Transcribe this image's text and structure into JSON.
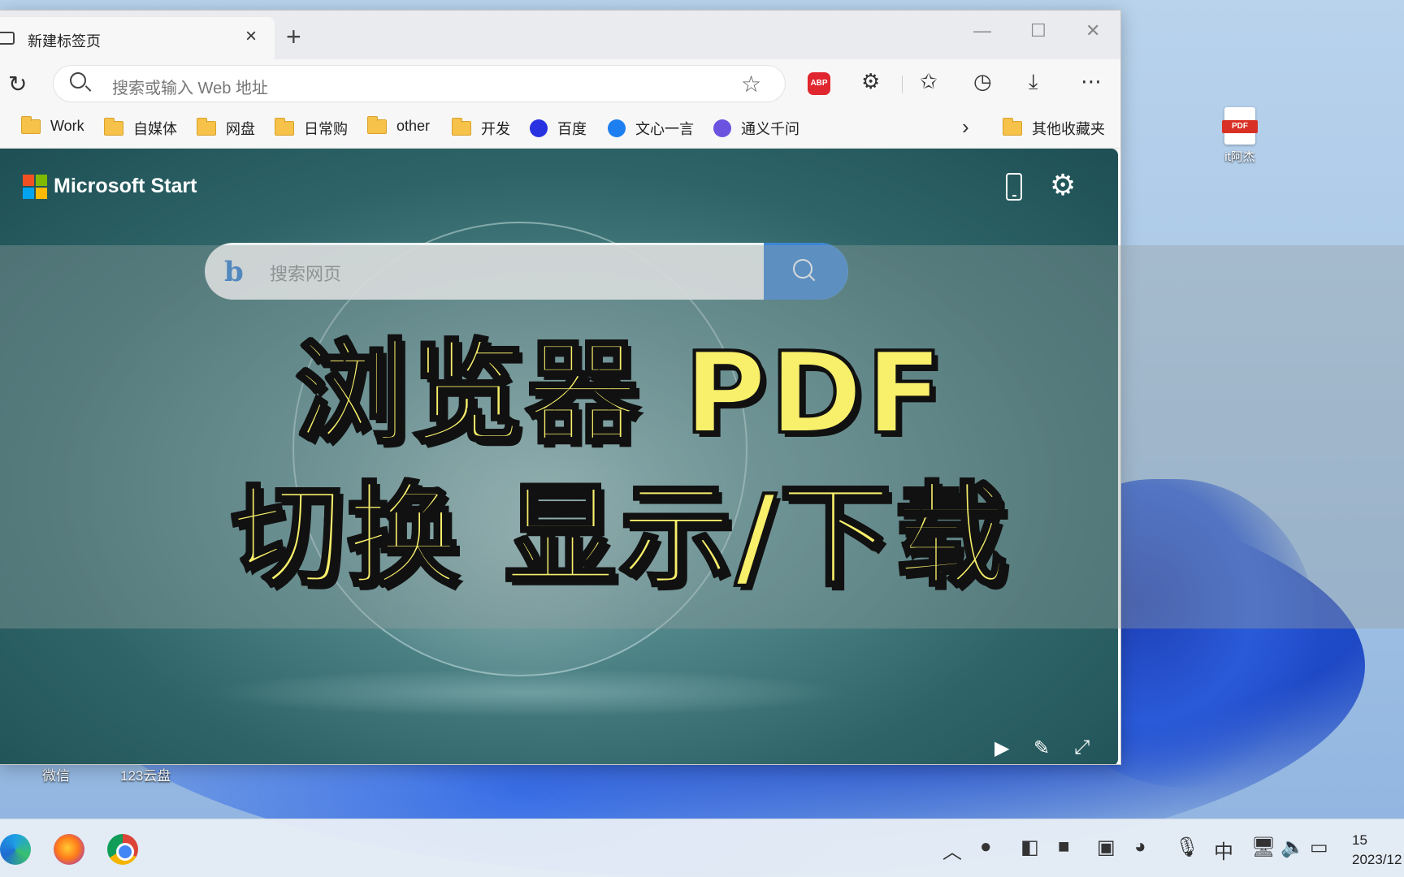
{
  "desktop": {
    "pdf_icon_label": "it阿杰",
    "pdf_badge": "PDF",
    "bottom_labels": [
      "微信",
      "123云盘"
    ]
  },
  "browser": {
    "tab_title": "新建标签页",
    "new_tab": "+",
    "address_placeholder": "搜索或输入 Web 地址",
    "bookmarks": [
      {
        "label": "Work",
        "kind": "folder"
      },
      {
        "label": "自媒体",
        "kind": "folder"
      },
      {
        "label": "网盘",
        "kind": "folder"
      },
      {
        "label": "日常购",
        "kind": "folder"
      },
      {
        "label": "other",
        "kind": "folder"
      },
      {
        "label": "开发",
        "kind": "folder"
      },
      {
        "label": "百度",
        "kind": "site"
      },
      {
        "label": "文心一言",
        "kind": "site"
      },
      {
        "label": "通义千问",
        "kind": "site"
      }
    ],
    "other_bookmarks": "其他收藏夹",
    "abp_label": "ABP"
  },
  "newtab": {
    "brand": "Microsoft Start",
    "bing_logo": "b",
    "search_placeholder": "搜索网页"
  },
  "overlay": {
    "line1": "浏览器 PDF",
    "line2": "切换 显示/下载"
  },
  "taskbar": {
    "ime": "中",
    "clock_time": "15",
    "clock_date": "2023/12"
  },
  "colors": {
    "headline_fill": "#f8ef6a",
    "bing_button": "#3b86d6",
    "abp_red": "#e0262e"
  }
}
